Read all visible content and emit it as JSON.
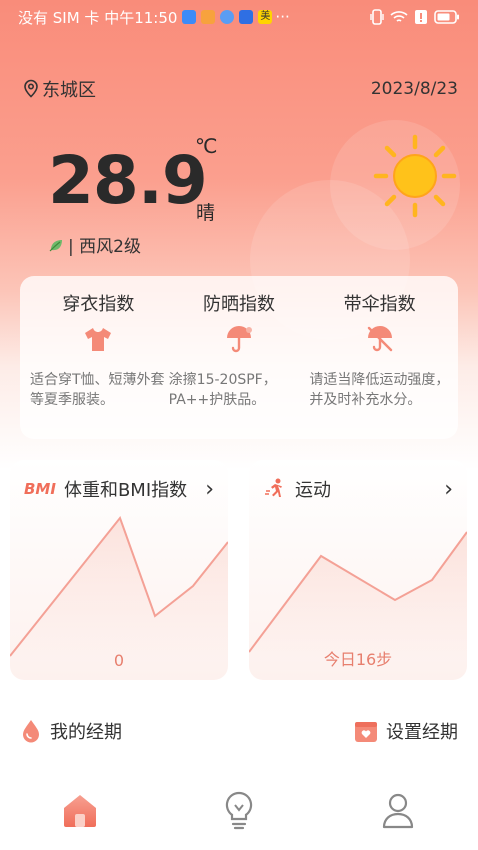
{
  "status_bar": {
    "carrier": "没有 SIM 卡 中午11:50",
    "more": "···",
    "app_badge": "美"
  },
  "location": {
    "district": "东城区",
    "date": "2023/8/23"
  },
  "weather": {
    "temperature": "28.9",
    "unit": "℃",
    "condition": "晴",
    "wind": "| 西风2级"
  },
  "indices": [
    {
      "title": "穿衣指数",
      "desc": "适合穿T恤、短薄外套等夏季服装。",
      "icon": "tshirt-icon"
    },
    {
      "title": "防晒指数",
      "desc": "涂擦15-20SPF，PA++护肤品。",
      "icon": "umbrella-sun-icon"
    },
    {
      "title": "带伞指数",
      "desc": "请适当降低运动强度，并及时补充水分。",
      "icon": "no-umbrella-icon"
    }
  ],
  "tiles": {
    "bmi": {
      "badge": "BMI",
      "title": "体重和BMI指数",
      "value": "0",
      "chevron": "›"
    },
    "sport": {
      "title": "运动",
      "value": "今日16步",
      "chevron": "›"
    }
  },
  "period": {
    "my_label": "我的经期",
    "set_label": "设置经期"
  },
  "tabs": [
    {
      "name": "home",
      "icon": "home-icon",
      "active": true
    },
    {
      "name": "tips",
      "icon": "bulb-icon",
      "active": false
    },
    {
      "name": "profile",
      "icon": "user-icon",
      "active": false
    }
  ],
  "colors": {
    "accent": "#f98c7a",
    "chart_line": "#f4a196",
    "sun": "#ffb51f"
  }
}
